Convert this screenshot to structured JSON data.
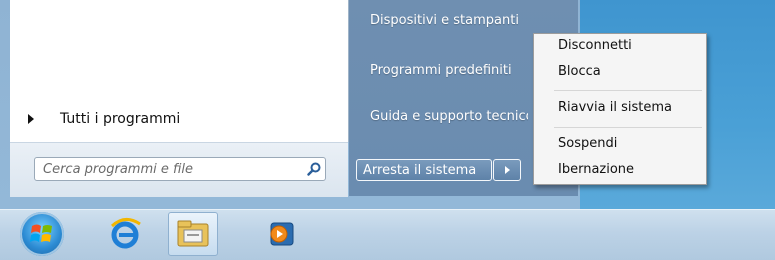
{
  "start_menu": {
    "all_programs_label": "Tutti i programmi",
    "search": {
      "placeholder": "Cerca programmi e file"
    },
    "right_items": [
      "Dispositivi e stampanti",
      "Programmi predefiniti",
      "Guida e supporto tecnico"
    ],
    "shutdown_label": "Arresta il sistema"
  },
  "power_submenu": {
    "items": [
      "Disconnetti",
      "Blocca",
      "Riavvia il sistema",
      "Sospendi",
      "Ibernazione"
    ]
  },
  "taskbar": {
    "icons": [
      "windows-orb-icon",
      "internet-explorer-icon",
      "file-explorer-icon",
      "media-player-icon"
    ]
  },
  "colors": {
    "accent": "#6a8cb0",
    "taskbar": "#bcd2e6",
    "desktop": "#4aa0d6"
  }
}
